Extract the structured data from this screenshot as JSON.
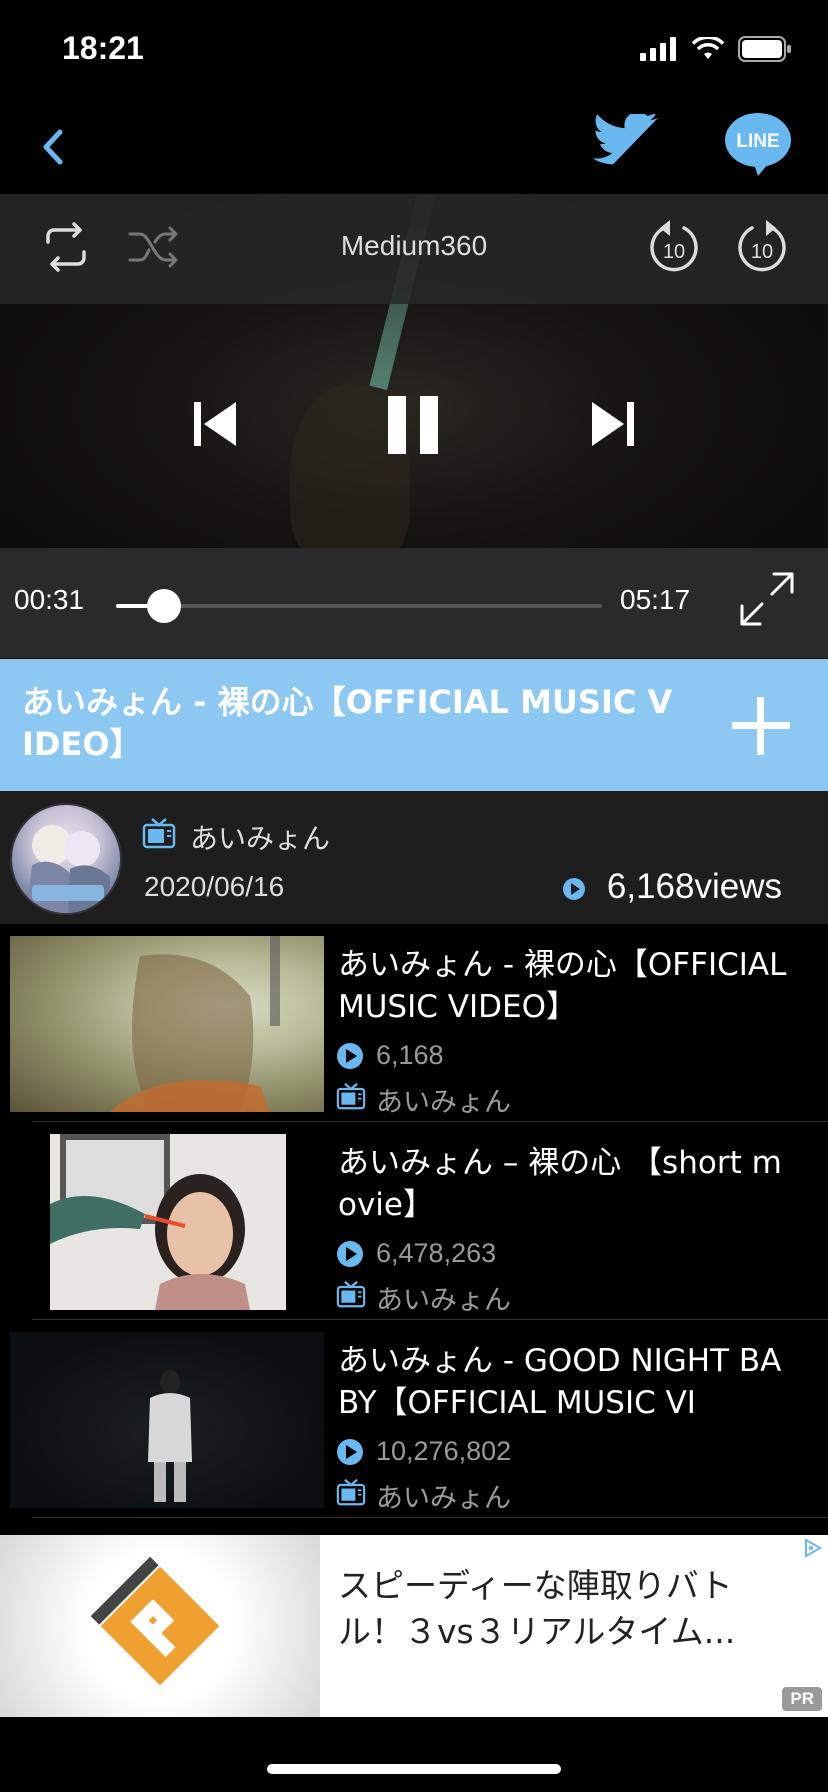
{
  "status_bar": {
    "time": "18:21"
  },
  "nav": {
    "line_label": "LINE"
  },
  "player": {
    "quality": "Medium360",
    "current_time": "00:31",
    "duration": "05:17",
    "progress": 0.098,
    "skip_back_label": "10",
    "skip_forward_label": "10"
  },
  "video": {
    "title": "あいみょん - 裸の心【OFFICIAL MUSIC VIDEO】",
    "channel": "あいみょん",
    "date": "2020/06/16",
    "views": "6,168views"
  },
  "related": [
    {
      "title": "あいみょん - 裸の心【OFFICIAL MUSIC VIDEO】",
      "views": "6,168",
      "channel": "あいみょん"
    },
    {
      "title": "あいみょん – 裸の心 【short movie】",
      "views": "6,478,263",
      "channel": "あいみょん"
    },
    {
      "title": "あいみょん - GOOD NIGHT BABY【OFFICIAL MUSIC VI",
      "views": "10,276,802",
      "channel": "あいみょん"
    }
  ],
  "ad": {
    "text": "スピーディーな陣取りバトル！３vs３リアルタイム...",
    "pr_label": "PR"
  },
  "colors": {
    "accent": "#8cc8f2",
    "icon_blue": "#6ab8f0"
  }
}
